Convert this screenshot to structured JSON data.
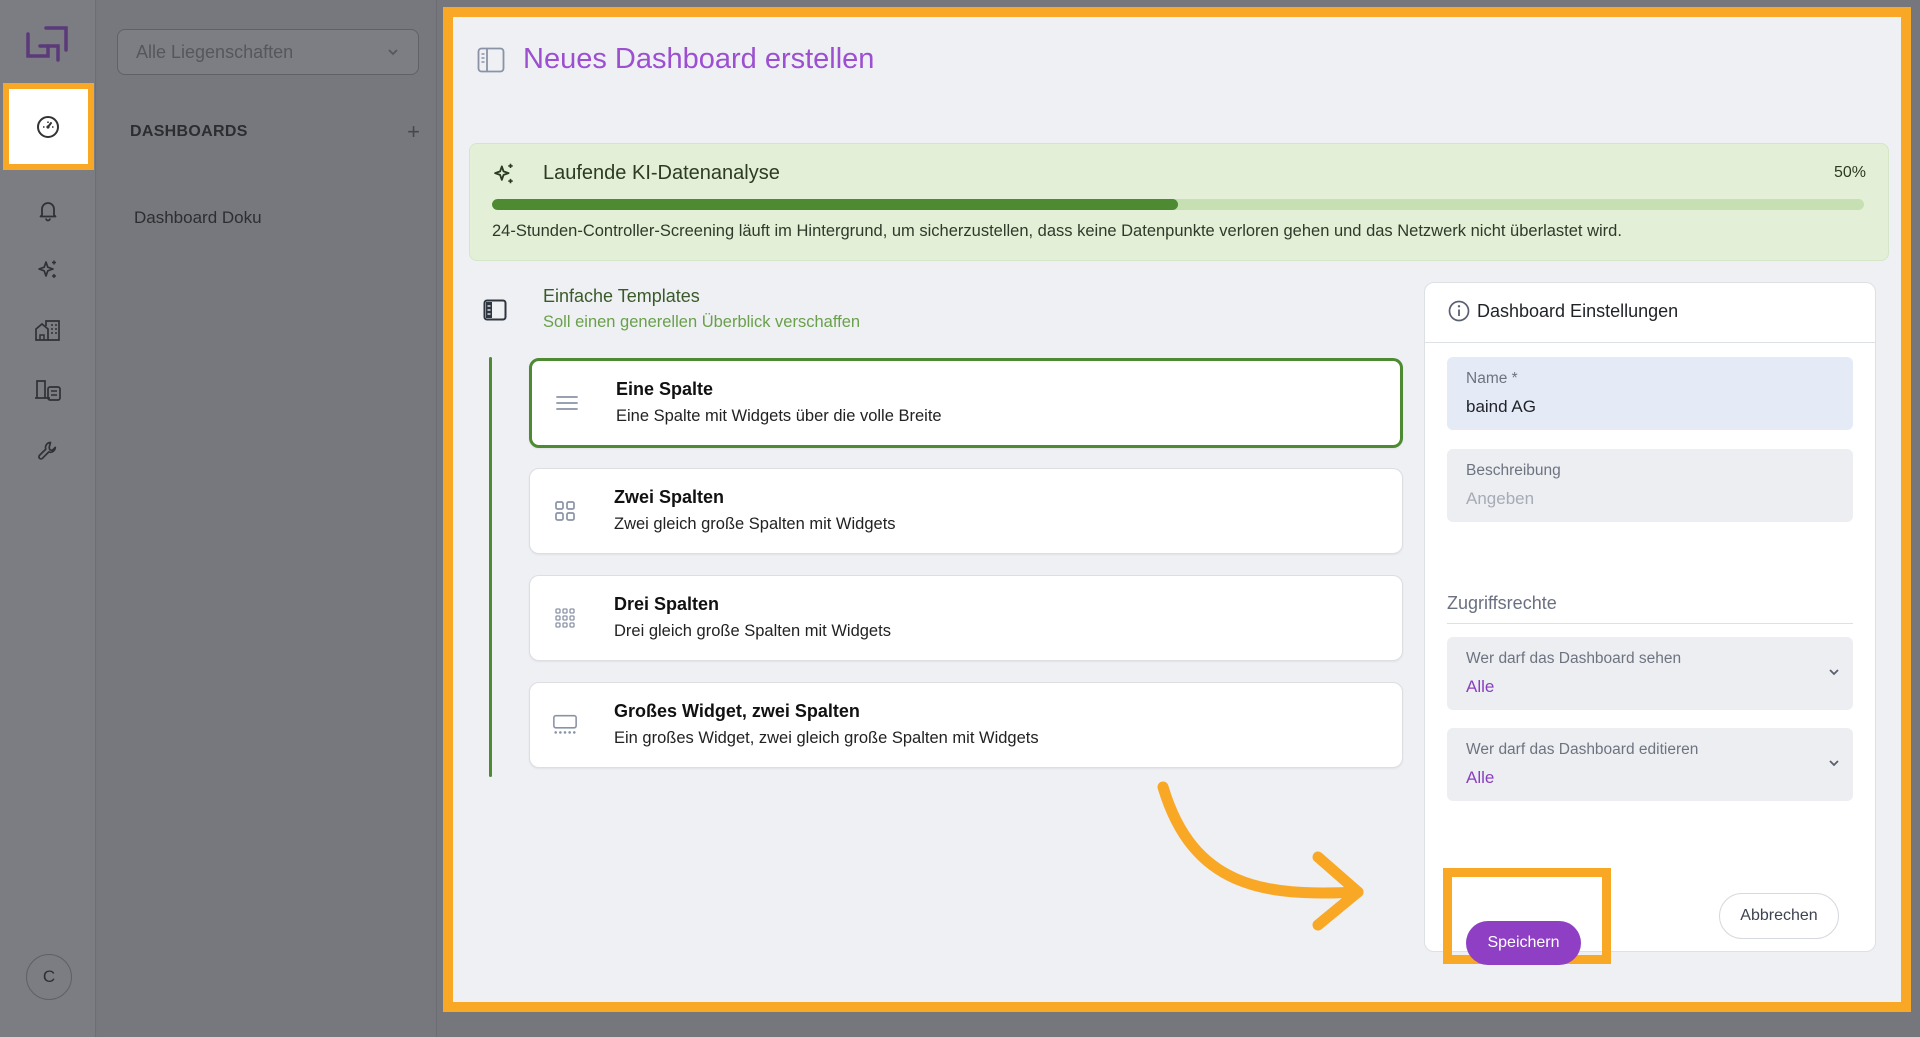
{
  "sidebar": {
    "property_select": "Alle Liegenschaften",
    "section_title": "DASHBOARDS",
    "add_label": "+",
    "items": [
      {
        "label": "Dashboard Doku"
      }
    ],
    "avatar_initial": "C"
  },
  "rail": {
    "icons": [
      "logo-icon",
      "dashboard-gauge-icon",
      "bell-icon",
      "sparkles-icon",
      "buildings-icon",
      "device-list-icon",
      "wrench-icon"
    ]
  },
  "modal": {
    "title": "Neues Dashboard erstellen",
    "ai_analysis": {
      "title": "Laufende KI-Datenanalyse",
      "percent_label": "50%",
      "progress": 0.5,
      "description": "24-Stunden-Controller-Screening läuft im Hintergrund, um sicherzustellen, dass keine Datenpunkte verloren gehen und das Netzwerk nicht überlastet wird."
    },
    "templates": {
      "title": "Einfache Templates",
      "subtitle": "Soll einen generellen Überblick verschaffen",
      "items": [
        {
          "title": "Eine Spalte",
          "description": "Eine Spalte mit Widgets über die volle Breite",
          "icon": "one-column-icon",
          "selected": true
        },
        {
          "title": "Zwei Spalten",
          "description": "Zwei gleich große Spalten mit Widgets",
          "icon": "two-columns-icon",
          "selected": false
        },
        {
          "title": "Drei Spalten",
          "description": "Drei gleich große Spalten mit Widgets",
          "icon": "three-columns-icon",
          "selected": false
        },
        {
          "title": "Großes Widget, zwei Spalten",
          "description": "Ein großes Widget, zwei gleich große Spalten mit Widgets",
          "icon": "large-widget-icon",
          "selected": false
        }
      ]
    },
    "settings": {
      "title": "Dashboard Einstellungen",
      "name_label": "Name *",
      "name_value": "baind AG",
      "description_label": "Beschreibung",
      "description_placeholder": "Angeben",
      "access_title": "Zugriffsrechte",
      "view_label": "Wer darf das Dashboard sehen",
      "view_value": "Alle",
      "edit_label": "Wer darf das Dashboard editieren",
      "edit_value": "Alle",
      "save_label": "Speichern",
      "cancel_label": "Abbrechen"
    }
  },
  "colors": {
    "accent_purple": "#8e3fc3",
    "highlight_orange": "#f9a825",
    "progress_green": "#4e8a32"
  }
}
